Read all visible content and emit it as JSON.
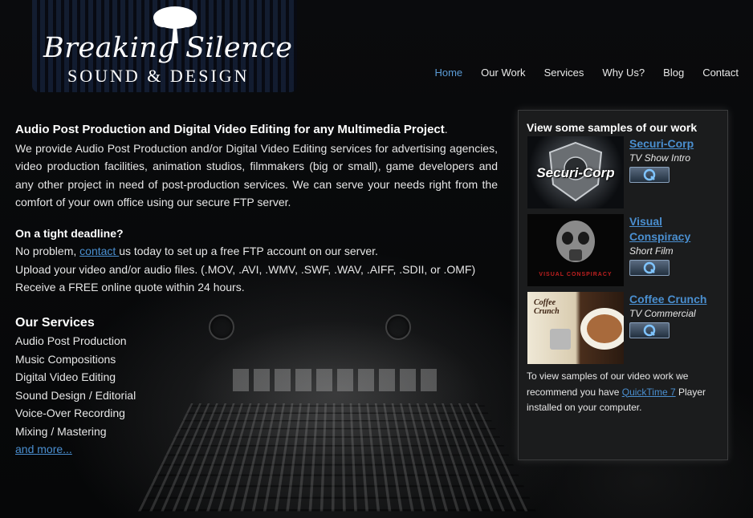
{
  "brand": {
    "name_main": "Breaking Silence",
    "name_sub": "SOUND & DESIGN"
  },
  "nav": {
    "items": [
      "Home",
      "Our Work",
      "Services",
      "Why Us?",
      "Blog",
      "Contact"
    ],
    "active": "Home"
  },
  "intro": {
    "heading": "Audio Post Production and Digital Video Editing for any Multimedia Project",
    "heading_suffix": ".",
    "body": "We provide Audio Post Production and/or Digital Video Editing services for advertising agencies, video production facilities, animation studios, filmmakers (big or small), game developers and any other project in need of post-production services. We can serve your needs right from the comfort of your own office using our secure FTP server."
  },
  "deadline": {
    "heading": "On a tight deadline?",
    "line1_prefix": "No problem, ",
    "line1_link": "contact ",
    "line1_suffix": "us today to set up a free FTP account on our server.",
    "line2": "Upload your video and/or audio files. (.MOV, .AVI, .WMV, .SWF, .WAV, .AIFF, .SDII, or .OMF)",
    "line3": "Receive a FREE online quote within 24 hours."
  },
  "services": {
    "heading": "Our Services",
    "items": [
      "Audio Post Production",
      "Music Compositions",
      "Digital Video Editing",
      "Sound Design / Editorial",
      "Voice-Over Recording",
      "Mixing / Mastering"
    ],
    "more_link": "and more..."
  },
  "sidebar": {
    "title": "View some samples of our work",
    "samples": [
      {
        "title": "Securi-Corp",
        "type": "TV Show Intro",
        "thumb_text": "Securi-Corp"
      },
      {
        "title": "Visual Conspiracy",
        "type": "Short Film",
        "thumb_text": "VISUAL CONSPIRACY"
      },
      {
        "title": "Coffee Crunch",
        "type": "TV Commercial",
        "thumb_text": "Coffee Crunch"
      }
    ],
    "note_prefix": "To view samples of our video work we recommend you have ",
    "note_link": "QuickTime 7",
    "note_suffix": " Player installed on your computer.",
    "colors": {
      "link": "#4a8fd0",
      "active_nav": "#5b9bd5"
    }
  }
}
